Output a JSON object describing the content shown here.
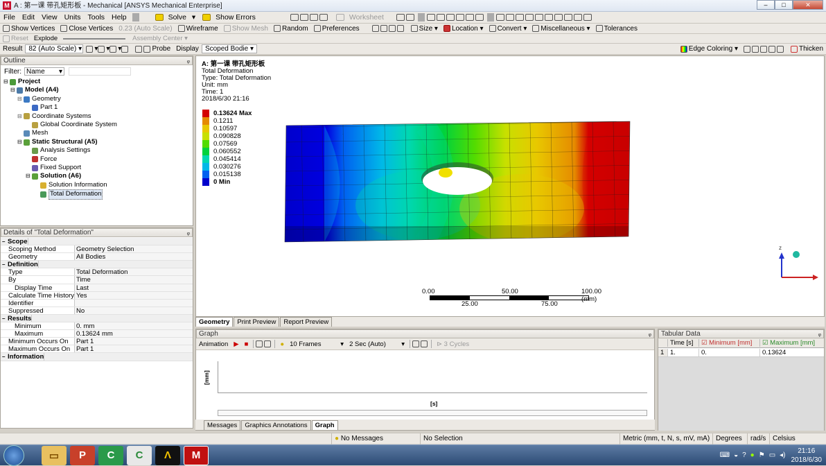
{
  "window": {
    "title": "A : 第一课 带孔矩形板 - Mechanical [ANSYS Mechanical Enterprise]",
    "min": "–",
    "max": "□",
    "close": "✕"
  },
  "menu": [
    "File",
    "Edit",
    "View",
    "Units",
    "Tools",
    "Help"
  ],
  "toolbar1": {
    "solve": "Solve",
    "show_errors": "Show Errors",
    "worksheet": "Worksheet"
  },
  "toolbar2": {
    "show_vertices": "Show Vertices",
    "close_vertices": "Close Vertices",
    "auto_scale": "0.23 (Auto Scale)",
    "wireframe": "Wireframe",
    "show_mesh": "Show Mesh",
    "random": "Random",
    "preferences": "Preferences",
    "size": "Size",
    "location": "Location",
    "convert": "Convert",
    "miscellaneous": "Miscellaneous",
    "tolerances": "Tolerances"
  },
  "toolbar3": {
    "reset": "Reset",
    "explode": "Explode",
    "assembly_center": "Assembly Center"
  },
  "toolbar4": {
    "result": "Result",
    "scale": "82 (Auto Scale)",
    "probe": "Probe",
    "display": "Display",
    "scoped": "Scoped Bodie",
    "edge_coloring": "Edge Coloring",
    "thicken": "Thicken"
  },
  "outline": {
    "title": "Outline",
    "pin": "ᵩ",
    "filter_label": "Filter:",
    "filter_value": "Name",
    "items": [
      {
        "label": "Project",
        "bold": true,
        "color": "#4c9a3a"
      },
      {
        "label": "Model (A4)",
        "bold": true,
        "color": "#4c7aa8"
      },
      {
        "label": "Geometry",
        "bold": false,
        "color": "#3c7ac4"
      },
      {
        "label": "Part 1",
        "bold": false,
        "color": "#3c6ac4"
      },
      {
        "label": "Coordinate Systems",
        "bold": false,
        "color": "#b8a040"
      },
      {
        "label": "Global Coordinate System",
        "bold": false,
        "color": "#b8a040"
      },
      {
        "label": "Mesh",
        "bold": false,
        "color": "#5a8ab8"
      },
      {
        "label": "Static Structural (A5)",
        "bold": true,
        "color": "#5aa03a"
      },
      {
        "label": "Analysis Settings",
        "bold": false,
        "color": "#6a9a4a"
      },
      {
        "label": "Force",
        "bold": false,
        "color": "#c03030"
      },
      {
        "label": "Fixed Support",
        "bold": false,
        "color": "#6a5ab0"
      },
      {
        "label": "Solution (A6)",
        "bold": true,
        "color": "#5aa03a"
      },
      {
        "label": "Solution Information",
        "bold": false,
        "color": "#d8b030"
      },
      {
        "label": "Total Deformation",
        "bold": false,
        "color": "#4a9a5a"
      }
    ]
  },
  "details": {
    "title": "Details of \"Total Deformation\"",
    "pin": "ᵩ",
    "rows": [
      {
        "type": "sec",
        "k": "Scope",
        "v": ""
      },
      {
        "type": "row",
        "k": "Scoping Method",
        "v": "Geometry Selection"
      },
      {
        "type": "row",
        "k": "Geometry",
        "v": "All Bodies"
      },
      {
        "type": "sec",
        "k": "Definition",
        "v": ""
      },
      {
        "type": "row",
        "k": "Type",
        "v": "Total Deformation"
      },
      {
        "type": "row",
        "k": "By",
        "v": "Time"
      },
      {
        "type": "sub",
        "k": "Display Time",
        "v": "Last"
      },
      {
        "type": "row",
        "k": "Calculate Time History",
        "v": "Yes"
      },
      {
        "type": "row",
        "k": "Identifier",
        "v": ""
      },
      {
        "type": "row",
        "k": "Suppressed",
        "v": "No"
      },
      {
        "type": "sec",
        "k": "Results",
        "v": ""
      },
      {
        "type": "sub",
        "k": "Minimum",
        "v": "0. mm"
      },
      {
        "type": "sub",
        "k": "Maximum",
        "v": "0.13624 mm"
      },
      {
        "type": "row",
        "k": "Minimum Occurs On",
        "v": "Part 1"
      },
      {
        "type": "row",
        "k": "Maximum Occurs On",
        "v": "Part 1"
      },
      {
        "type": "sec",
        "k": "Information",
        "v": ""
      }
    ]
  },
  "result": {
    "header": "A: 第一课 带孔矩形板",
    "name": "Total Deformation",
    "type": "Type: Total Deformation",
    "unit": "Unit: mm",
    "time": "Time: 1",
    "date": "2018/6/30 21:16",
    "legend": [
      {
        "label": "0.13624 Max",
        "color": "#d40000"
      },
      {
        "label": "0.1211",
        "color": "#e58a00"
      },
      {
        "label": "0.10597",
        "color": "#e8c800"
      },
      {
        "label": "0.090828",
        "color": "#c8e000"
      },
      {
        "label": "0.07569",
        "color": "#52dc00"
      },
      {
        "label": "0.060552",
        "color": "#00d23c"
      },
      {
        "label": "0.045414",
        "color": "#00d8b0"
      },
      {
        "label": "0.030276",
        "color": "#00b8e8"
      },
      {
        "label": "0.015138",
        "color": "#0060f0"
      },
      {
        "label": "0 Min",
        "color": "#0000cc"
      }
    ],
    "scale_top": [
      "0.00",
      "50.00",
      "100.00 (mm)"
    ],
    "scale_bottom": [
      "25.00",
      "75.00"
    ]
  },
  "view_tabs": [
    "Geometry",
    "Print Preview",
    "Report Preview"
  ],
  "graph": {
    "title": "Graph",
    "animation": "Animation",
    "frames": "10 Frames",
    "duration": "2 Sec (Auto)",
    "cycles": "3 Cycles",
    "yaxis": "[mm]",
    "xaxis": "[s]",
    "pin": "ᵩ"
  },
  "bottom_tabs": [
    "Messages",
    "Graphics Annotations",
    "Graph"
  ],
  "tabular": {
    "title": "Tabular Data",
    "pin": "ᵩ",
    "headers": [
      "Time [s]",
      "Minimum [mm]",
      "Maximum [mm]"
    ],
    "rows": [
      {
        "idx": "1",
        "time": "1.",
        "min": "0.",
        "max": "0.13624"
      }
    ]
  },
  "status": {
    "messages": "No Messages",
    "selection": "No Selection",
    "units": "Metric (mm, t, N, s, mV, mA)",
    "degrees": "Degrees",
    "rads": "rad/s",
    "celsius": "Celsius"
  },
  "taskbar": {
    "time": "21:16",
    "date": "2018/6/30"
  },
  "colors": {
    "panel_bg": "#ece9e4",
    "accent": "#3c6ac4"
  }
}
